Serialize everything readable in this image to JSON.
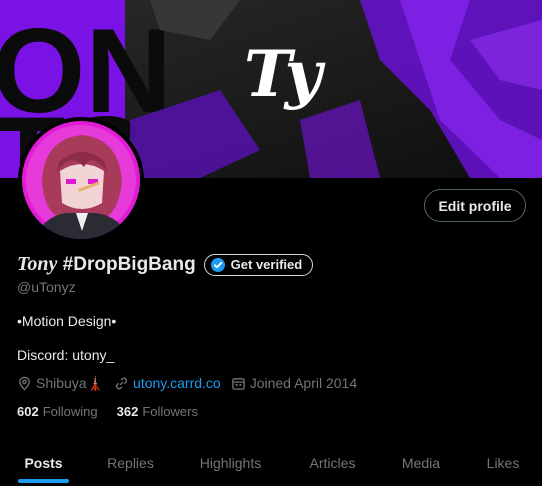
{
  "banner": {
    "logo_text": "Ty",
    "bg_letters": "ON TS"
  },
  "profile": {
    "display_name_italic": "Tony",
    "display_name_rest": "#DropBigBang",
    "get_verified_label": "Get verified",
    "handle": "@uTonyz",
    "bio_line1": "•Motion Design•",
    "bio_line2": "Discord: utony_",
    "location": "Shibuya🗼",
    "website": "utony.carrd.co",
    "joined": "Joined April 2014",
    "following_count": "602",
    "following_label": "Following",
    "followers_count": "362",
    "followers_label": "Followers"
  },
  "actions": {
    "edit_profile_label": "Edit profile"
  },
  "tabs": [
    {
      "label": "Posts",
      "active": true
    },
    {
      "label": "Replies",
      "active": false
    },
    {
      "label": "Highlights",
      "active": false
    },
    {
      "label": "Articles",
      "active": false
    },
    {
      "label": "Media",
      "active": false
    },
    {
      "label": "Likes",
      "active": false
    }
  ],
  "colors": {
    "accent": "#1d9bf0",
    "banner_purple": "#7a12e6",
    "avatar_pink": "#e21bd6"
  }
}
